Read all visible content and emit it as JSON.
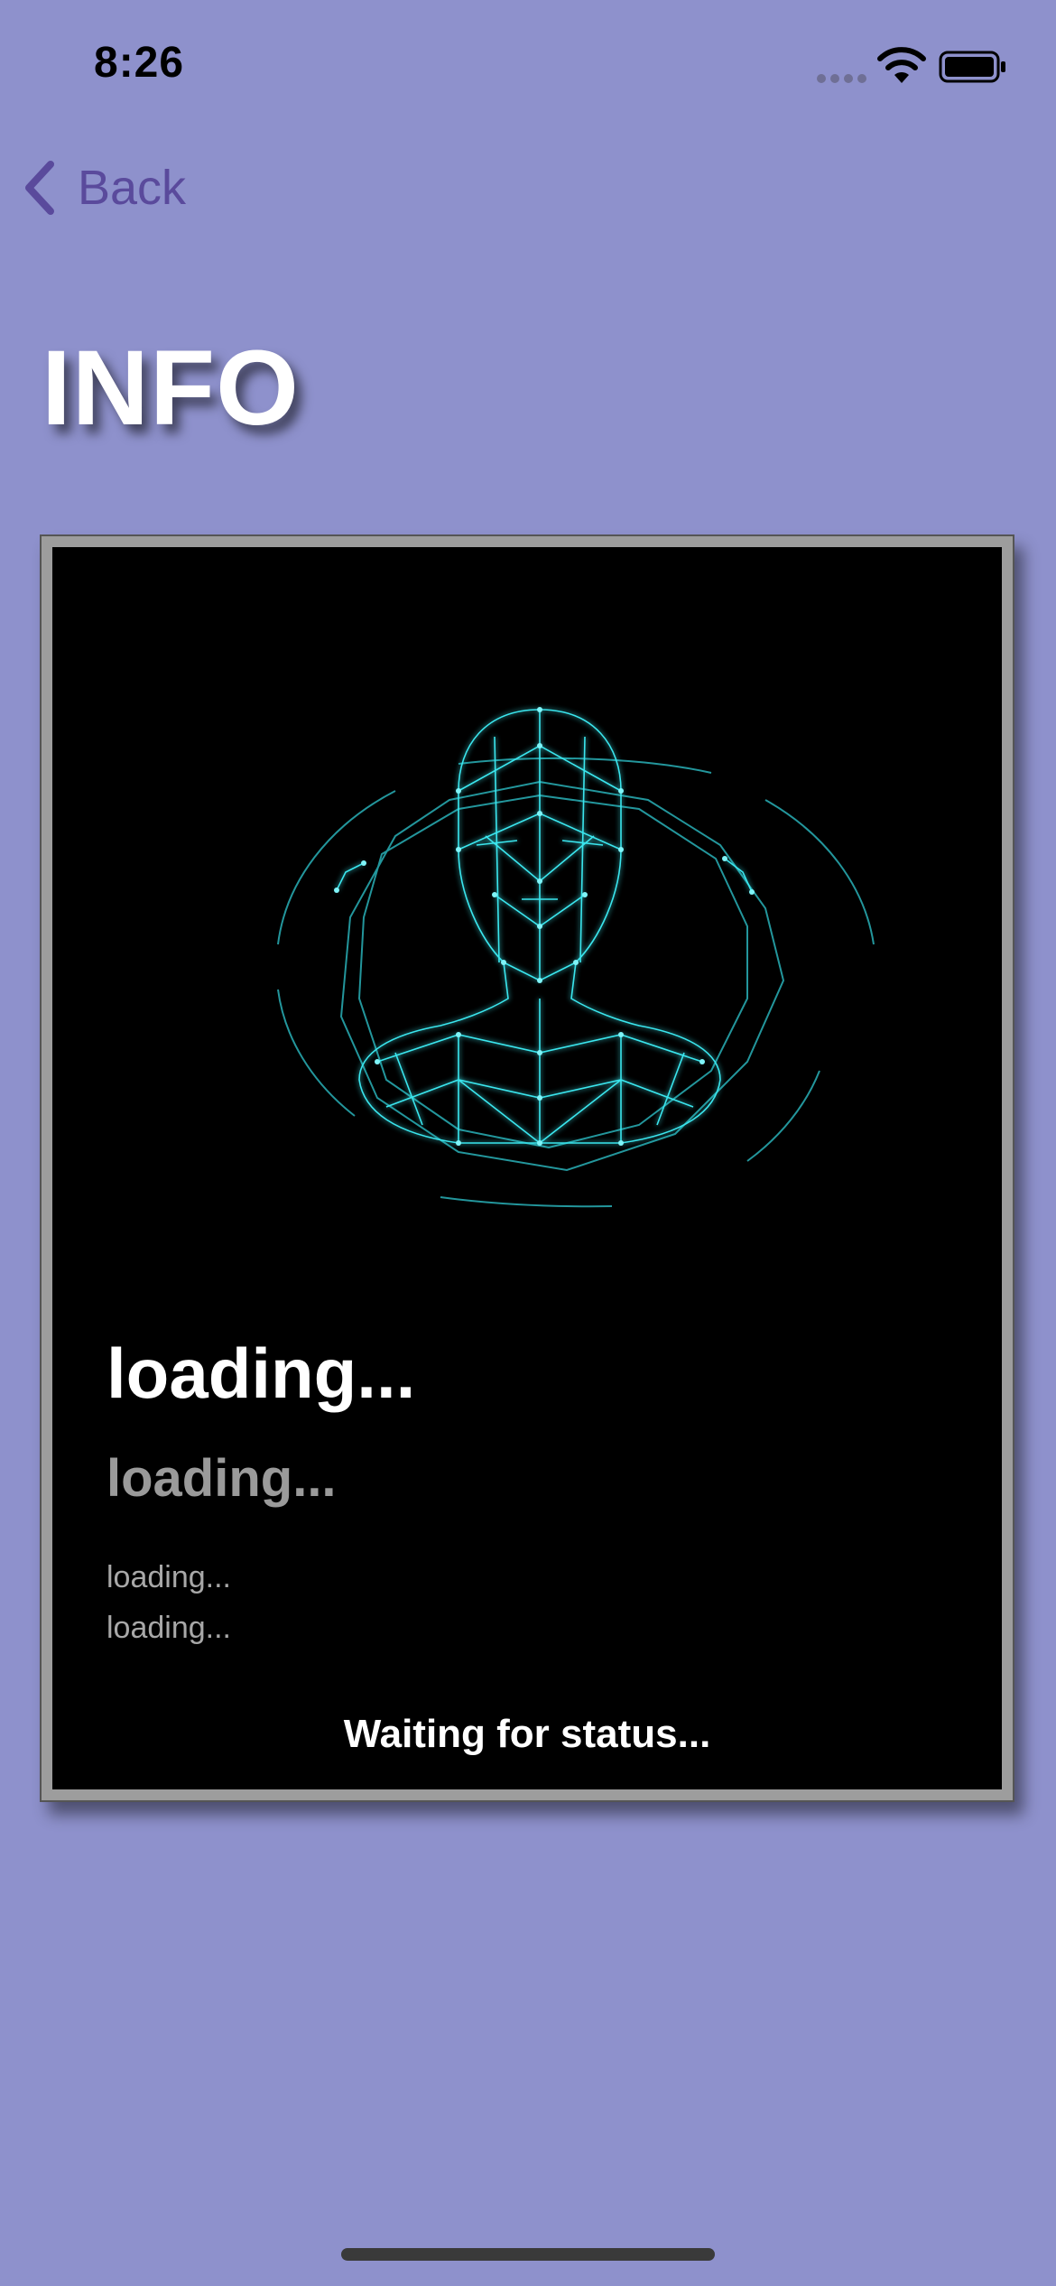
{
  "status_bar": {
    "time": "8:26"
  },
  "nav": {
    "back_label": "Back"
  },
  "page": {
    "title": "INFO"
  },
  "card": {
    "heading_large": "loading...",
    "heading_medium": "loading...",
    "detail_lines": [
      "loading...",
      "loading..."
    ],
    "status": "Waiting for status..."
  },
  "colors": {
    "background": "#8e91cc",
    "back_accent": "#5a4a9c",
    "card_frame": "#9d9d9d",
    "face_glow": "#33e0e8"
  },
  "icons": {
    "signal": "cellular-signal-icon",
    "wifi": "wifi-icon",
    "battery": "battery-icon",
    "back": "chevron-left-icon",
    "face": "face-mesh-icon"
  }
}
